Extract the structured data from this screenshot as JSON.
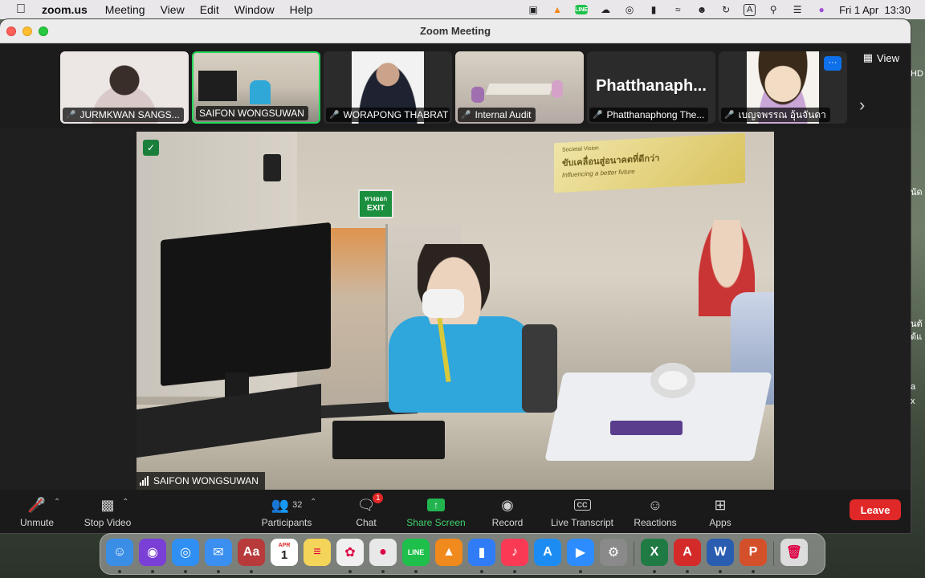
{
  "menubar": {
    "app_name": "zoom.us",
    "menus": [
      "Meeting",
      "View",
      "Edit",
      "Window",
      "Help"
    ],
    "status_icons": [
      "camera-icon",
      "vlc-icon",
      "line-icon",
      "cloud-icon",
      "airdrop-icon",
      "battery-icon",
      "wifi-icon",
      "user-icon",
      "time-machine-icon",
      "input-source-icon",
      "search-icon",
      "control-center-icon",
      "siri-icon"
    ],
    "line_label": "LINE",
    "input_source": "A",
    "clock": "Fri 1 Apr  13:30"
  },
  "window": {
    "title": "Zoom Meeting"
  },
  "strip": {
    "view_label": "View",
    "more_label": "···",
    "participants": [
      {
        "name": "JURMKWAN SANGS...",
        "muted": true,
        "type": "video",
        "bg": "#e8e2e0"
      },
      {
        "name": "SAIFON WONGSUWAN",
        "muted": false,
        "type": "video",
        "active": true,
        "bg": "#b9b3a6"
      },
      {
        "name": "WORAPONG THABRAT",
        "muted": true,
        "type": "photo",
        "bg": "#f2f2f2"
      },
      {
        "name": "Internal Audit",
        "muted": true,
        "type": "video",
        "bg": "#c9c3b7"
      },
      {
        "name": "Phatthanaphong The...",
        "muted": true,
        "type": "name",
        "display": "Phatthanaph..."
      },
      {
        "name": "เบญจพรรณ อุ้นจันดา",
        "muted": true,
        "type": "avatar",
        "bg": "#f6f3ee"
      }
    ]
  },
  "main_video": {
    "speaker_name": "SAIFON WONGSUWAN",
    "exit_sign": "EXIT",
    "exit_sign_thai": "ทางออก",
    "banner_thai": "ขับเคลื่อนสู่อนาคตที่ดีกว่า",
    "banner_en": "Influencing a better future",
    "banner_top": "Societal Vision"
  },
  "toolbar": {
    "unmute": "Unmute",
    "stop_video": "Stop Video",
    "participants": "Participants",
    "participants_count": "32",
    "chat": "Chat",
    "chat_badge": "1",
    "share_screen": "Share Screen",
    "record": "Record",
    "live_transcript": "Live Transcript",
    "cc_label": "CC",
    "reactions": "Reactions",
    "apps": "Apps",
    "leave": "Leave"
  },
  "dock": {
    "apps": [
      {
        "name": "finder",
        "label": "☺",
        "color": "#3a8ee6"
      },
      {
        "name": "siri",
        "label": "◉",
        "color": "#7a3fd6"
      },
      {
        "name": "safari",
        "label": "◎",
        "color": "#2f8ff2"
      },
      {
        "name": "mail",
        "label": "✉",
        "color": "#3b8ff0"
      },
      {
        "name": "dictionary",
        "label": "Aa",
        "color": "#b83a3a"
      },
      {
        "name": "calendar",
        "label": "1",
        "color": "#ffffff"
      },
      {
        "name": "notes",
        "label": "≡",
        "color": "#f5d45a"
      },
      {
        "name": "photos",
        "label": "✿",
        "color": "#f0f0f0"
      },
      {
        "name": "chrome",
        "label": "●",
        "color": "#e8e8e8"
      },
      {
        "name": "line",
        "label": "LINE",
        "color": "#1ec04b"
      },
      {
        "name": "vlc",
        "label": "▲",
        "color": "#f08a1c"
      },
      {
        "name": "keynote",
        "label": "▮",
        "color": "#2f7cf6"
      },
      {
        "name": "music",
        "label": "♪",
        "color": "#fa3a55"
      },
      {
        "name": "app-store",
        "label": "A",
        "color": "#1c8cf2"
      },
      {
        "name": "zoom",
        "label": "▶",
        "color": "#2d8cff"
      },
      {
        "name": "system-preferences",
        "label": "⚙",
        "color": "#8a8a8a"
      },
      {
        "name": "excel",
        "label": "X",
        "color": "#1f7a44"
      },
      {
        "name": "acrobat",
        "label": "A",
        "color": "#d42a2a"
      },
      {
        "name": "word",
        "label": "W",
        "color": "#2a5db0"
      },
      {
        "name": "powerpoint",
        "label": "P",
        "color": "#d4502a"
      },
      {
        "name": "trash",
        "label": "🗑",
        "color": "#dcdcdc"
      }
    ],
    "calendar_month": "APR"
  },
  "desktop": {
    "fragments": [
      "HD",
      "นัด",
      "นตั",
      "ด้แ",
      "a",
      "x"
    ]
  },
  "colors": {
    "accent_green": "#23d959",
    "leave_red": "#e02828",
    "share_green": "#22b54f",
    "zoom_blue": "#0e71eb"
  }
}
